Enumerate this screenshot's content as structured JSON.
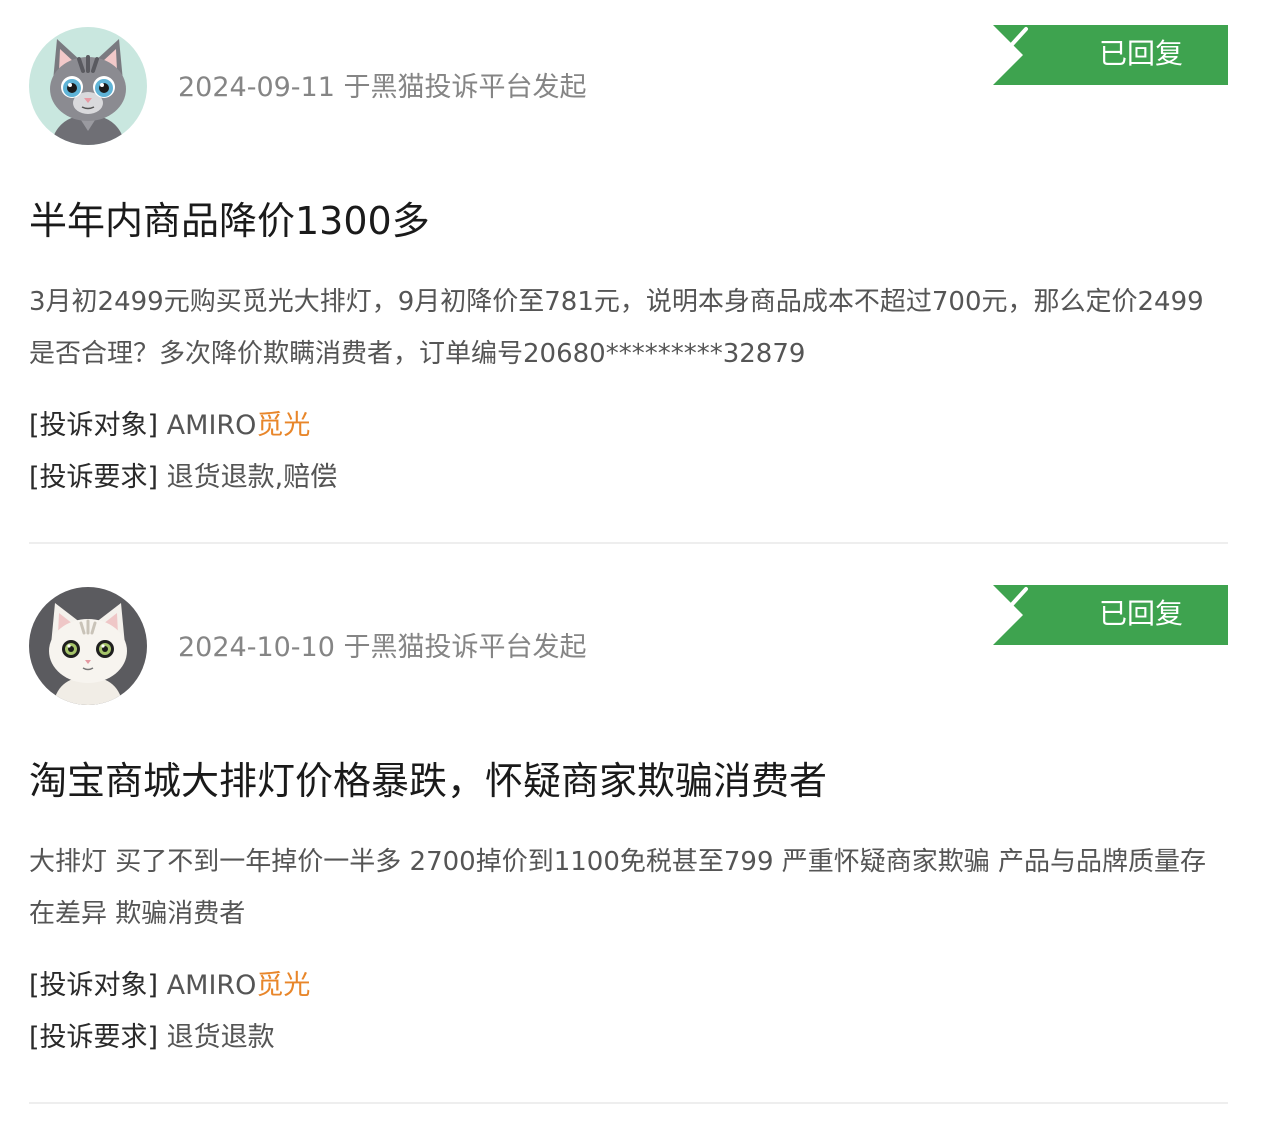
{
  "colors": {
    "badge_green": "#3ea34f",
    "brand_orange": "#e8862a",
    "meta_gray": "#858585"
  },
  "complaints": [
    {
      "avatar": "gray-tabby-cat-avatar",
      "date": "2024-09-11",
      "platform_text": "于黑猫投诉平台发起",
      "status": "已回复",
      "title": "半年内商品降价1300多",
      "description": "3月初2499元购买觅光大排灯，9月初降价至781元，说明本身商品成本不超过700元，那么定价2499是否合理？多次降价欺瞒消费者，订单编号20680*********32879",
      "target_label": "[投诉对象]",
      "target_value": "AMIRO",
      "target_brand": "觅光",
      "request_label": "[投诉要求]",
      "request_value": "退货退款,赔偿"
    },
    {
      "avatar": "white-cat-avatar",
      "date": "2024-10-10",
      "platform_text": "于黑猫投诉平台发起",
      "status": "已回复",
      "title": "淘宝商城大排灯价格暴跌，怀疑商家欺骗消费者",
      "description": "大排灯 买了不到一年掉价一半多 2700掉价到1100免税甚至799 严重怀疑商家欺骗 产品与品牌质量存在差异 欺骗消费者",
      "target_label": "[投诉对象]",
      "target_value": "AMIRO",
      "target_brand": "觅光",
      "request_label": "[投诉要求]",
      "request_value": "退货退款"
    }
  ]
}
